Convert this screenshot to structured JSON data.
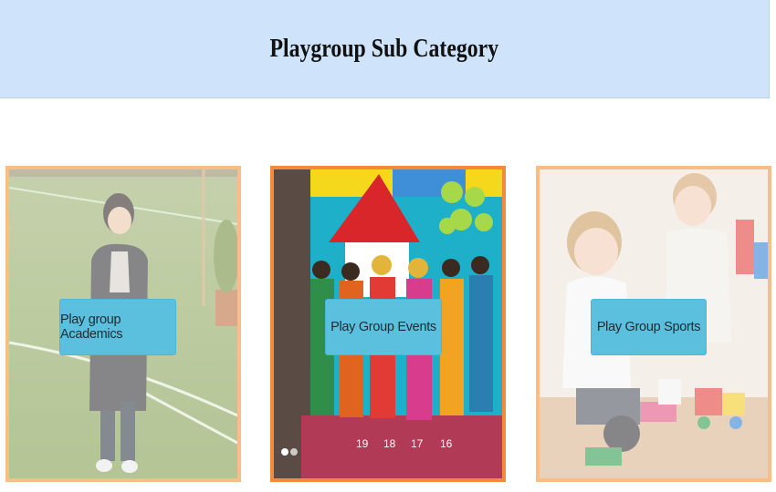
{
  "header": {
    "title": "Playgroup Sub Category"
  },
  "cards": [
    {
      "label": "Play group Academics",
      "image": "child-running-on-grass-photo"
    },
    {
      "label": "Play Group Events",
      "image": "kids-in-traditional-costume-photo"
    },
    {
      "label": "Play Group Sports",
      "image": "toddlers-playing-with-toys-photo"
    }
  ],
  "colors": {
    "header_bg": "#cfe4fb",
    "card_border": "#f9bd88",
    "card_border_active": "#f5893a",
    "button_bg": "#5bc0de"
  }
}
